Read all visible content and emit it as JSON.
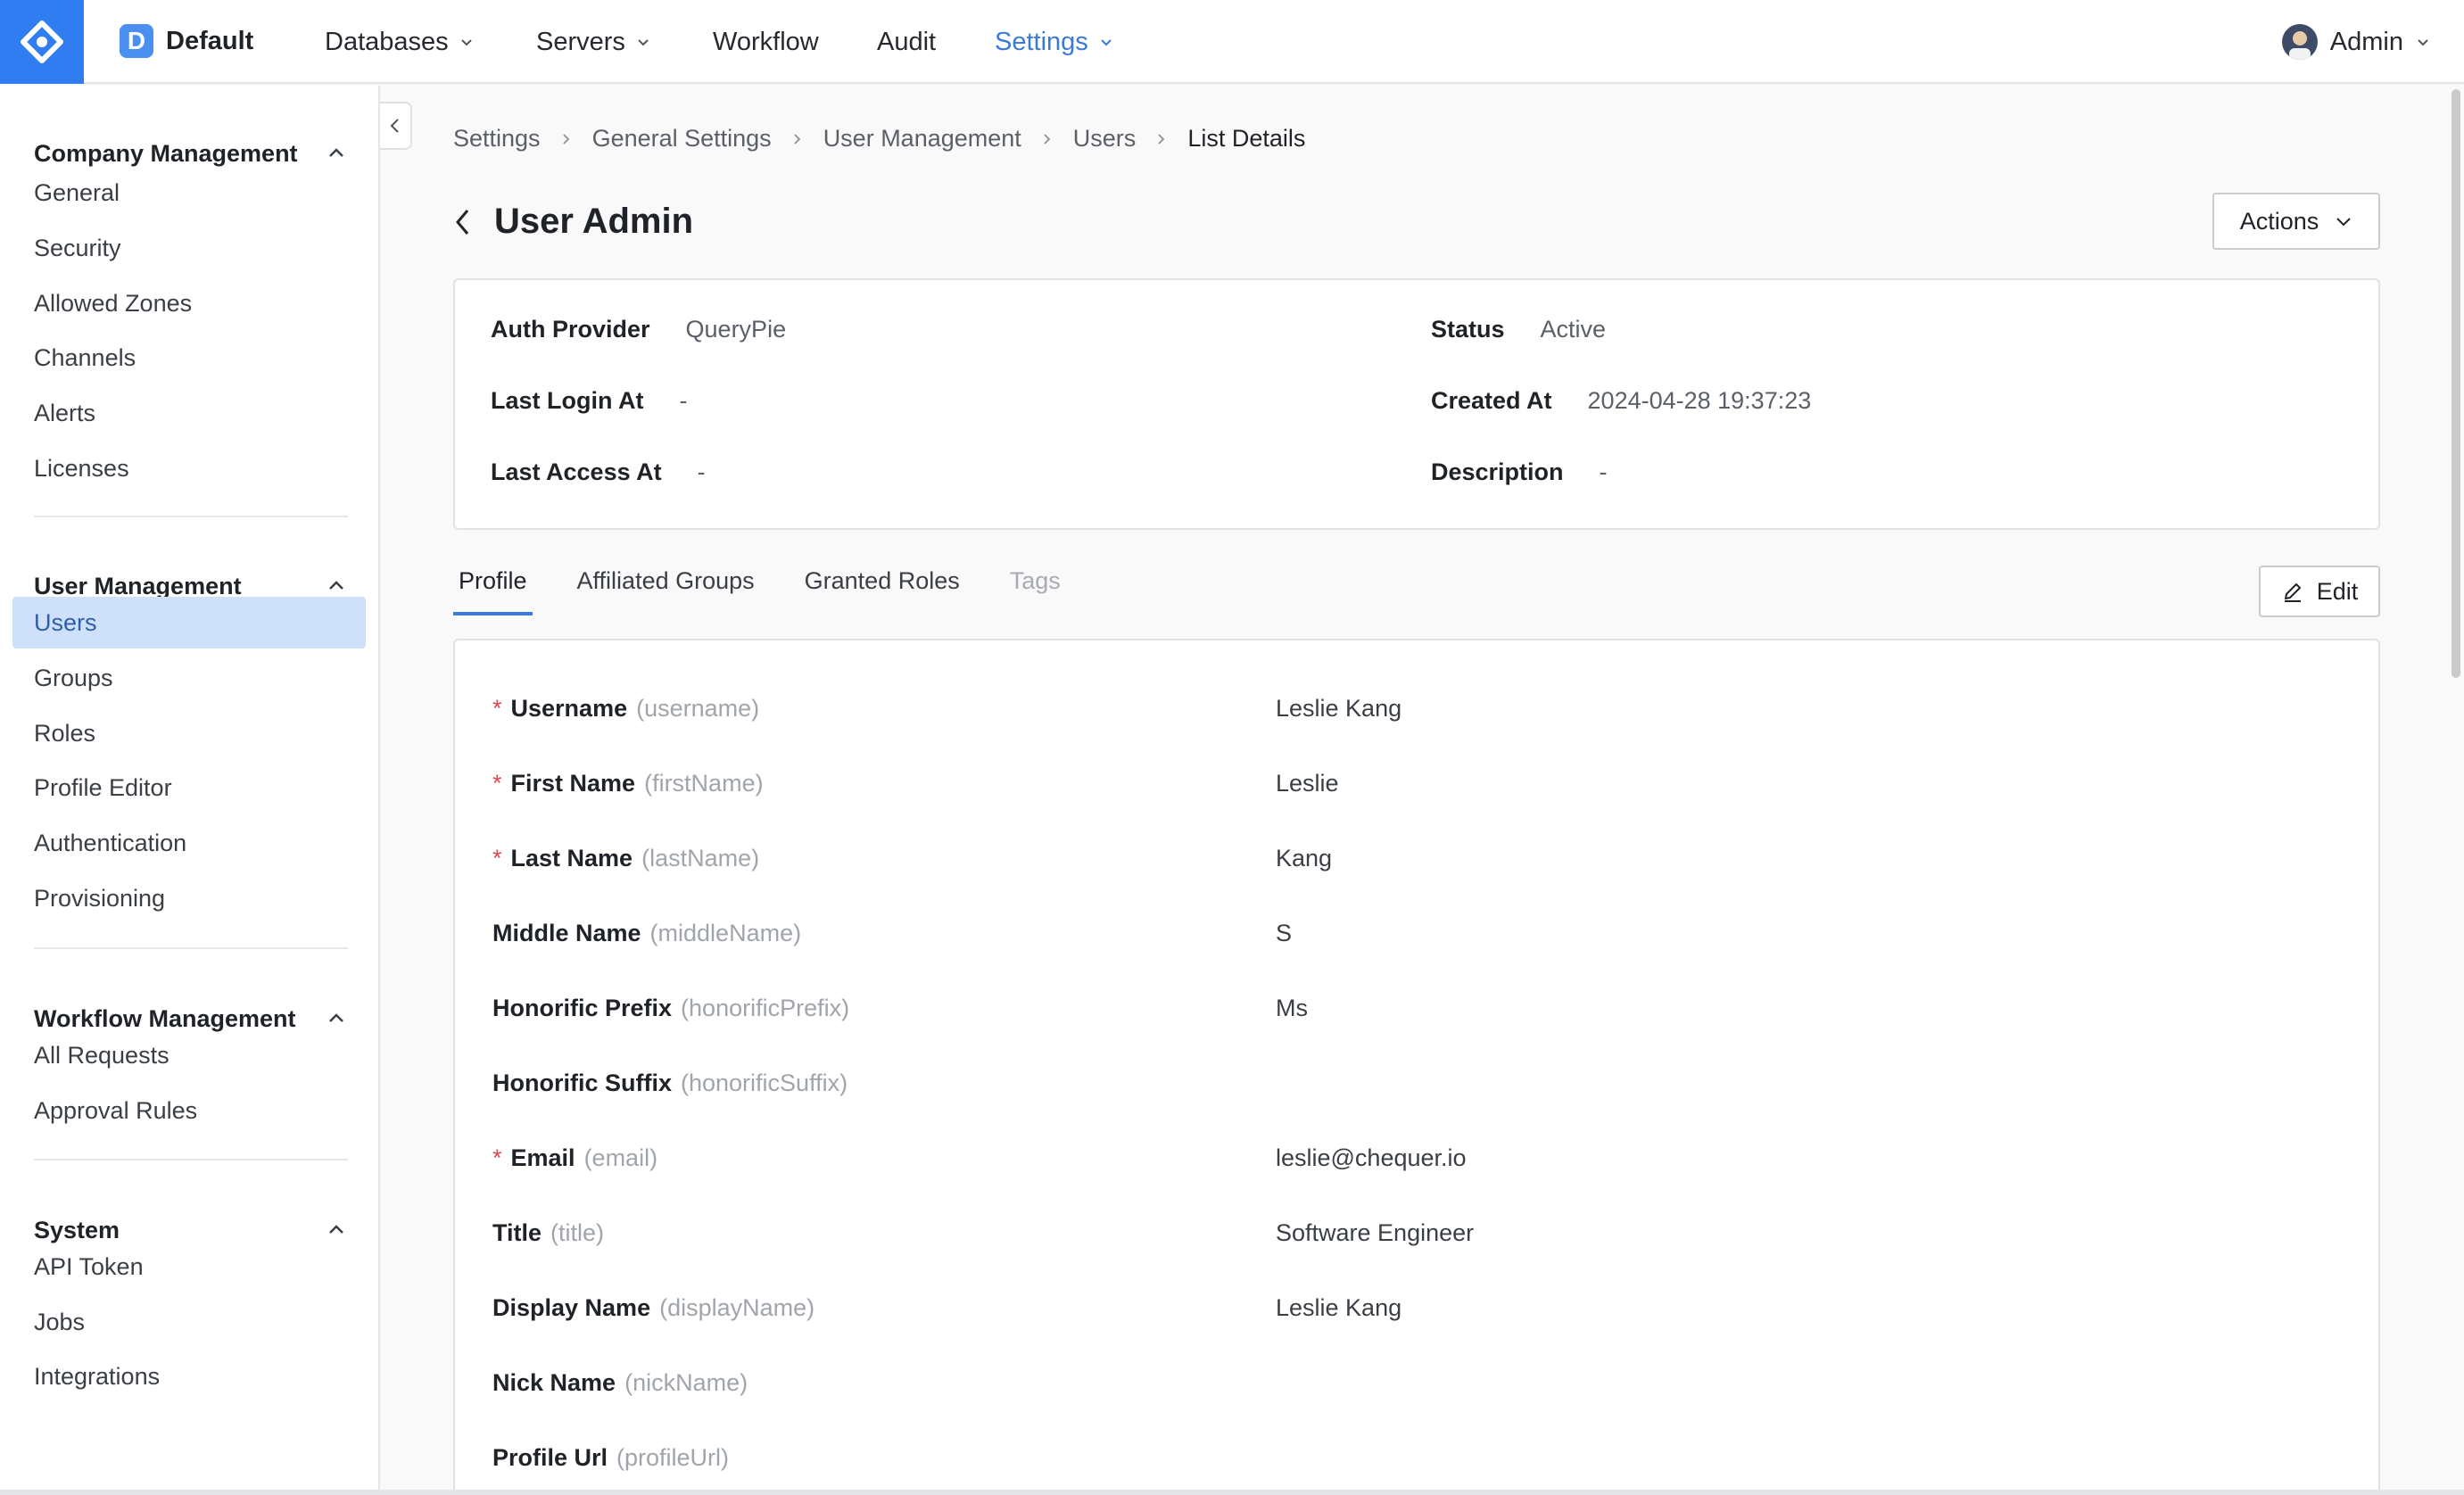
{
  "topbar": {
    "workspace_badge": "D",
    "workspace_name": "Default",
    "nav": [
      {
        "label": "Databases",
        "has_menu": true,
        "active": false
      },
      {
        "label": "Servers",
        "has_menu": true,
        "active": false
      },
      {
        "label": "Workflow",
        "has_menu": false,
        "active": false
      },
      {
        "label": "Audit",
        "has_menu": false,
        "active": false
      },
      {
        "label": "Settings",
        "has_menu": true,
        "active": true
      }
    ],
    "user_label": "Admin",
    "accent_color": "#3b7ad9",
    "logo_color": "#2f7df0"
  },
  "sidebar": {
    "sections": [
      {
        "title": "Company Management",
        "items": [
          "General",
          "Security",
          "Allowed Zones",
          "Channels",
          "Alerts",
          "Licenses"
        ]
      },
      {
        "title": "User Management",
        "items": [
          "Users",
          "Groups",
          "Roles",
          "Profile Editor",
          "Authentication",
          "Provisioning"
        ]
      },
      {
        "title": "Workflow Management",
        "items": [
          "All Requests",
          "Approval Rules"
        ]
      },
      {
        "title": "System",
        "items": [
          "API Token",
          "Jobs",
          "Integrations"
        ]
      }
    ],
    "selected_item": "Users"
  },
  "breadcrumb": [
    "Settings",
    "General Settings",
    "User Management",
    "Users",
    "List Details"
  ],
  "page": {
    "title": "User Admin",
    "actions_label": "Actions"
  },
  "info": {
    "auth_provider": {
      "label": "Auth Provider",
      "value": "QueryPie"
    },
    "status": {
      "label": "Status",
      "value": "Active"
    },
    "last_login_at": {
      "label": "Last Login At",
      "value": "-"
    },
    "created_at": {
      "label": "Created At",
      "value": "2024-04-28 19:37:23"
    },
    "last_access_at": {
      "label": "Last Access At",
      "value": "-"
    },
    "description": {
      "label": "Description",
      "value": "-"
    }
  },
  "tabs": [
    {
      "label": "Profile",
      "state": "active"
    },
    {
      "label": "Affiliated Groups",
      "state": "normal"
    },
    {
      "label": "Granted Roles",
      "state": "normal"
    },
    {
      "label": "Tags",
      "state": "disabled"
    }
  ],
  "edit_label": "Edit",
  "profile_fields": [
    {
      "required": true,
      "label": "Username",
      "key": "(username)",
      "value": "Leslie Kang"
    },
    {
      "required": true,
      "label": "First Name",
      "key": "(firstName)",
      "value": "Leslie"
    },
    {
      "required": true,
      "label": "Last Name",
      "key": "(lastName)",
      "value": "Kang"
    },
    {
      "required": false,
      "label": "Middle Name",
      "key": "(middleName)",
      "value": "S"
    },
    {
      "required": false,
      "label": "Honorific Prefix",
      "key": "(honorificPrefix)",
      "value": "Ms"
    },
    {
      "required": false,
      "label": "Honorific Suffix",
      "key": "(honorificSuffix)",
      "value": ""
    },
    {
      "required": true,
      "label": "Email",
      "key": "(email)",
      "value": "leslie@chequer.io"
    },
    {
      "required": false,
      "label": "Title",
      "key": "(title)",
      "value": "Software Engineer"
    },
    {
      "required": false,
      "label": "Display Name",
      "key": "(displayName)",
      "value": "Leslie Kang"
    },
    {
      "required": false,
      "label": "Nick Name",
      "key": "(nickName)",
      "value": ""
    },
    {
      "required": false,
      "label": "Profile Url",
      "key": "(profileUrl)",
      "value": ""
    }
  ],
  "required_marker": "*"
}
